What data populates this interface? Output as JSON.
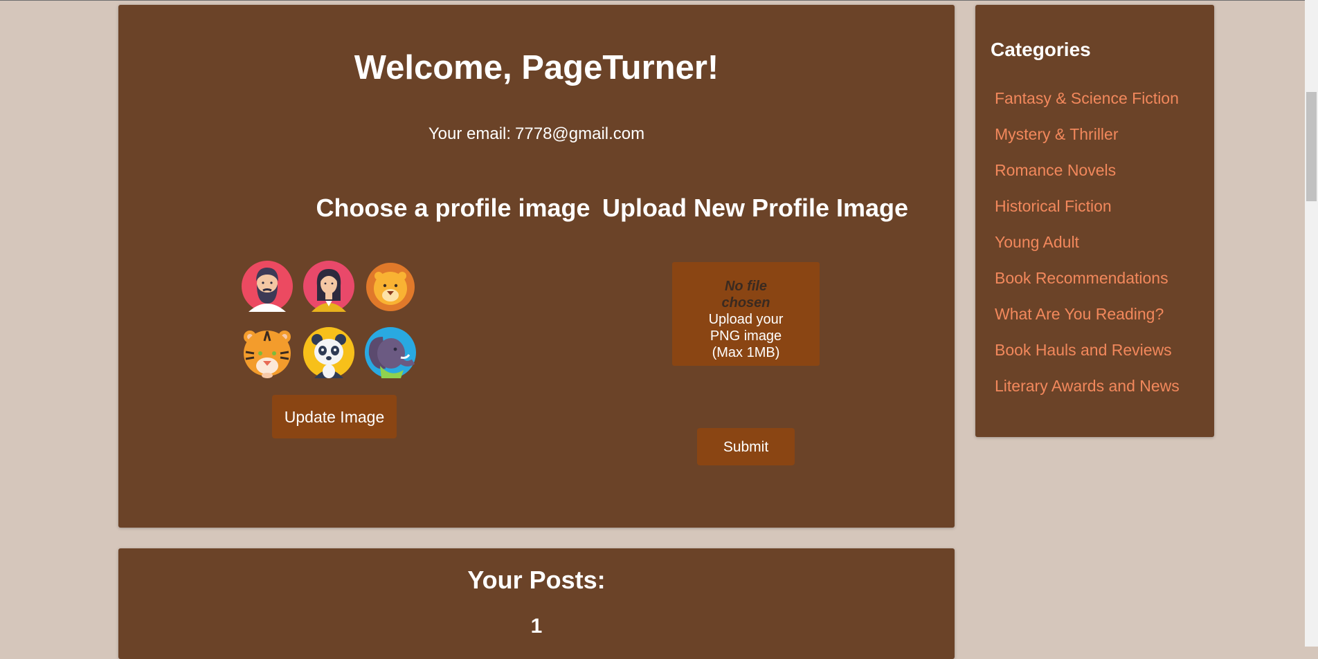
{
  "profile": {
    "welcome": "Welcome, PageTurner!",
    "email_label": "Your email:",
    "email": "7778@gmail.com"
  },
  "choose": {
    "heading": "Choose a profile image",
    "avatars": [
      "bearded-man-avatar",
      "woman-avatar",
      "lion-avatar",
      "tiger-avatar",
      "panda-avatar",
      "elephant-avatar"
    ],
    "update_label": "Update Image"
  },
  "upload": {
    "heading": "Upload New Profile Image",
    "file_status": "No file chosen",
    "hint": "Upload your PNG image (Max 1MB)",
    "submit_label": "Submit"
  },
  "posts": {
    "heading": "Your Posts:",
    "count": "1"
  },
  "categories": {
    "heading": "Categories",
    "items": [
      "Fantasy & Science Fiction",
      "Mystery & Thriller",
      "Romance Novels",
      "Historical Fiction",
      "Young Adult",
      "Book Recommendations",
      "What Are You Reading?",
      "Book Hauls and Reviews",
      "Literary Awards and News"
    ]
  },
  "colors": {
    "page_bg": "#d5c6bb",
    "panel_bg": "#6b4328",
    "button_bg": "#8a4513",
    "link": "#f2885c"
  }
}
